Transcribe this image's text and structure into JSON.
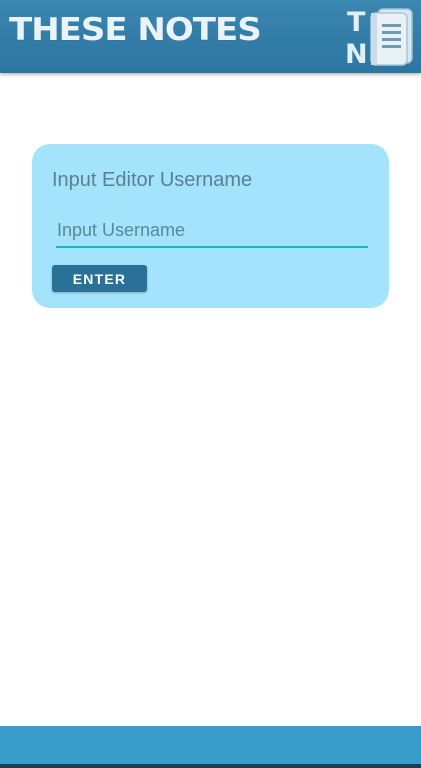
{
  "app": {
    "title": "These Notes",
    "logo_letters": [
      "T",
      "N"
    ],
    "colors": {
      "header": "#2f7aa6",
      "card": "#a3e3fb",
      "accent_underline": "#14b8c6",
      "button": "#2a7198",
      "bottom_bar": "#399ccb"
    }
  },
  "card": {
    "title": "Input Editor Username",
    "input_placeholder": "Input Username",
    "input_value": "",
    "button_label": "ENTER"
  },
  "icons": {
    "logo": "notebook-icon"
  }
}
